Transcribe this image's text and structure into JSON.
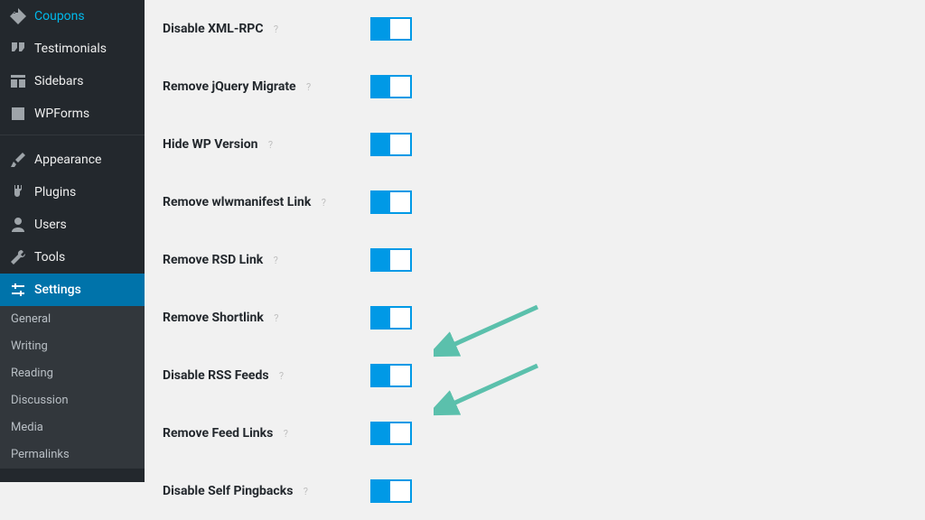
{
  "sidebar": {
    "main": [
      {
        "label": "Coupons",
        "icon": "tag-icon"
      },
      {
        "label": "Testimonials",
        "icon": "quote-icon"
      },
      {
        "label": "Sidebars",
        "icon": "layout-icon"
      },
      {
        "label": "WPForms",
        "icon": "form-icon"
      }
    ],
    "secondary": [
      {
        "label": "Appearance",
        "icon": "brush-icon"
      },
      {
        "label": "Plugins",
        "icon": "plug-icon"
      },
      {
        "label": "Users",
        "icon": "user-icon"
      },
      {
        "label": "Tools",
        "icon": "wrench-icon"
      }
    ],
    "current": {
      "label": "Settings",
      "icon": "sliders-icon"
    },
    "submenu": [
      "General",
      "Writing",
      "Reading",
      "Discussion",
      "Media",
      "Permalinks"
    ]
  },
  "settings": [
    {
      "label": "Disable XML-RPC",
      "on": true
    },
    {
      "label": "Remove jQuery Migrate",
      "on": true
    },
    {
      "label": "Hide WP Version",
      "on": true
    },
    {
      "label": "Remove wlwmanifest Link",
      "on": true
    },
    {
      "label": "Remove RSD Link",
      "on": true
    },
    {
      "label": "Remove Shortlink",
      "on": true
    },
    {
      "label": "Disable RSS Feeds",
      "on": true
    },
    {
      "label": "Remove Feed Links",
      "on": true
    },
    {
      "label": "Disable Self Pingbacks",
      "on": true
    }
  ],
  "annotations": {
    "arrows": [
      {
        "target_index": 6
      },
      {
        "target_index": 7
      }
    ],
    "color": "#5bc0ac"
  }
}
